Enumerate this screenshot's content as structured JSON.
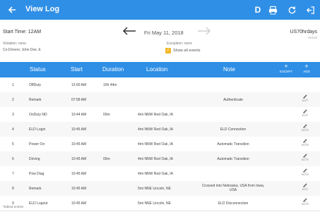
{
  "appbar": {
    "title": "View Log",
    "d_label": "D",
    "icons": [
      "back-arrow-icon",
      "print-icon",
      "refresh-icon",
      "logout-icon"
    ]
  },
  "header": {
    "start_time": "Start Time: 12AM",
    "date": "Fri May 11, 2018",
    "ruleset": "US70hrdays",
    "right_small": "70/100",
    "violation": "Violation: none",
    "exception": "Exception: none",
    "codrivers": "Co-Drivers: John Doe Jr.",
    "show_all_events": "Show all events",
    "show_all_checked": true
  },
  "table": {
    "columns": [
      "Status",
      "Start",
      "Duration",
      "Location",
      "Note"
    ],
    "except_label": "EXCEPT",
    "add_label": "ADD",
    "rows": [
      {
        "num": "1",
        "status": "OffDuty",
        "start": "12:00 AM",
        "duration": "10h 44m",
        "location": "",
        "note": "",
        "action": ""
      },
      {
        "num": "2",
        "status": "Remark",
        "start": "07:58 AM",
        "duration": "",
        "location": "",
        "note": "Authenticate",
        "action": "EDIT"
      },
      {
        "num": "3",
        "status": "OnDuty ND",
        "start": "10:44 AM",
        "duration": "00m",
        "location": "4mi NNW Red Oak, IA",
        "note": "",
        "action": "EDIT"
      },
      {
        "num": "4",
        "status": "ELD Login",
        "start": "10:45 AM",
        "duration": "",
        "location": "4mi NNW Red Oak, IA",
        "note": "ELD Connection",
        "action": "NOTE"
      },
      {
        "num": "5",
        "status": "Power On",
        "start": "10:45 AM",
        "duration": "",
        "location": "4mi NNW Red Oak, IA",
        "note": "Automatic Transition",
        "action": "NOTE"
      },
      {
        "num": "6",
        "status": "Driving",
        "start": "10:45 AM",
        "duration": "05m",
        "location": "4mi NNW Red Oak, IA",
        "note": "Automatic Transition",
        "action": "NOTE"
      },
      {
        "num": "7",
        "status": "Pow Diag",
        "start": "10:45 AM",
        "duration": "",
        "location": "4mi NNW Red Oak, IA",
        "note": "",
        "action": "NOTE"
      },
      {
        "num": "8",
        "status": "Remark",
        "start": "10:45 AM",
        "duration": "",
        "location": "5mi NNE Lincoln, NE",
        "note": "Crossed into Nebraska, USA from Iowa, USA",
        "action": "EDIT"
      },
      {
        "num": "9",
        "status": "ELD Logout",
        "start": "10:45 AM",
        "duration": "",
        "location": "5mi NNE Lincoln, NE",
        "note": "ELD Disconnection",
        "action": "NOTE"
      }
    ]
  },
  "footnote": "*Edited entries"
}
